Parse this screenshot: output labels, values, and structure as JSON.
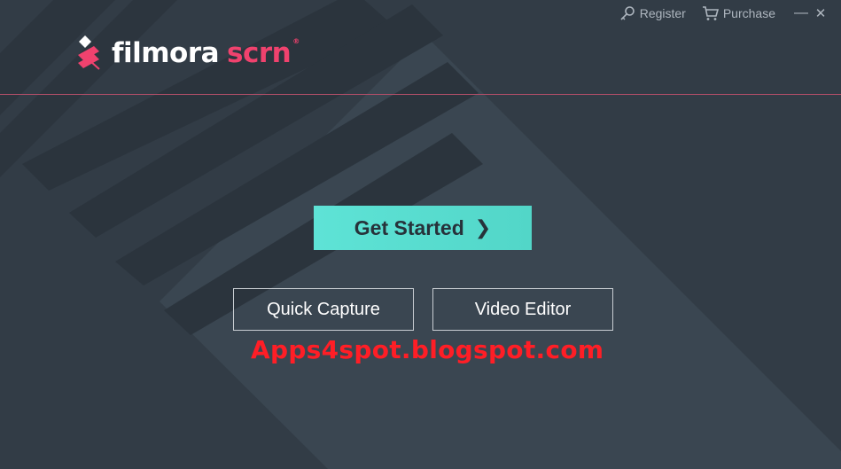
{
  "header": {
    "register_label": "Register",
    "purchase_label": "Purchase",
    "minimize_glyph": "—",
    "close_glyph": "✕"
  },
  "logo": {
    "word1": "filmora",
    "word2": "scrn",
    "mark": "®",
    "icon": "filmora-logo-icon"
  },
  "main": {
    "get_started_label": "Get Started",
    "get_started_chevron": "❯",
    "quick_capture_label": "Quick Capture",
    "video_editor_label": "Video Editor"
  },
  "watermark": "Apps4spot.blogspot.com",
  "colors": {
    "background": "#323c46",
    "accent_teal": "#5ee3d6",
    "brand_pink": "#f0426e",
    "divider": "#b04e68",
    "watermark_red": "#ff1e26"
  }
}
